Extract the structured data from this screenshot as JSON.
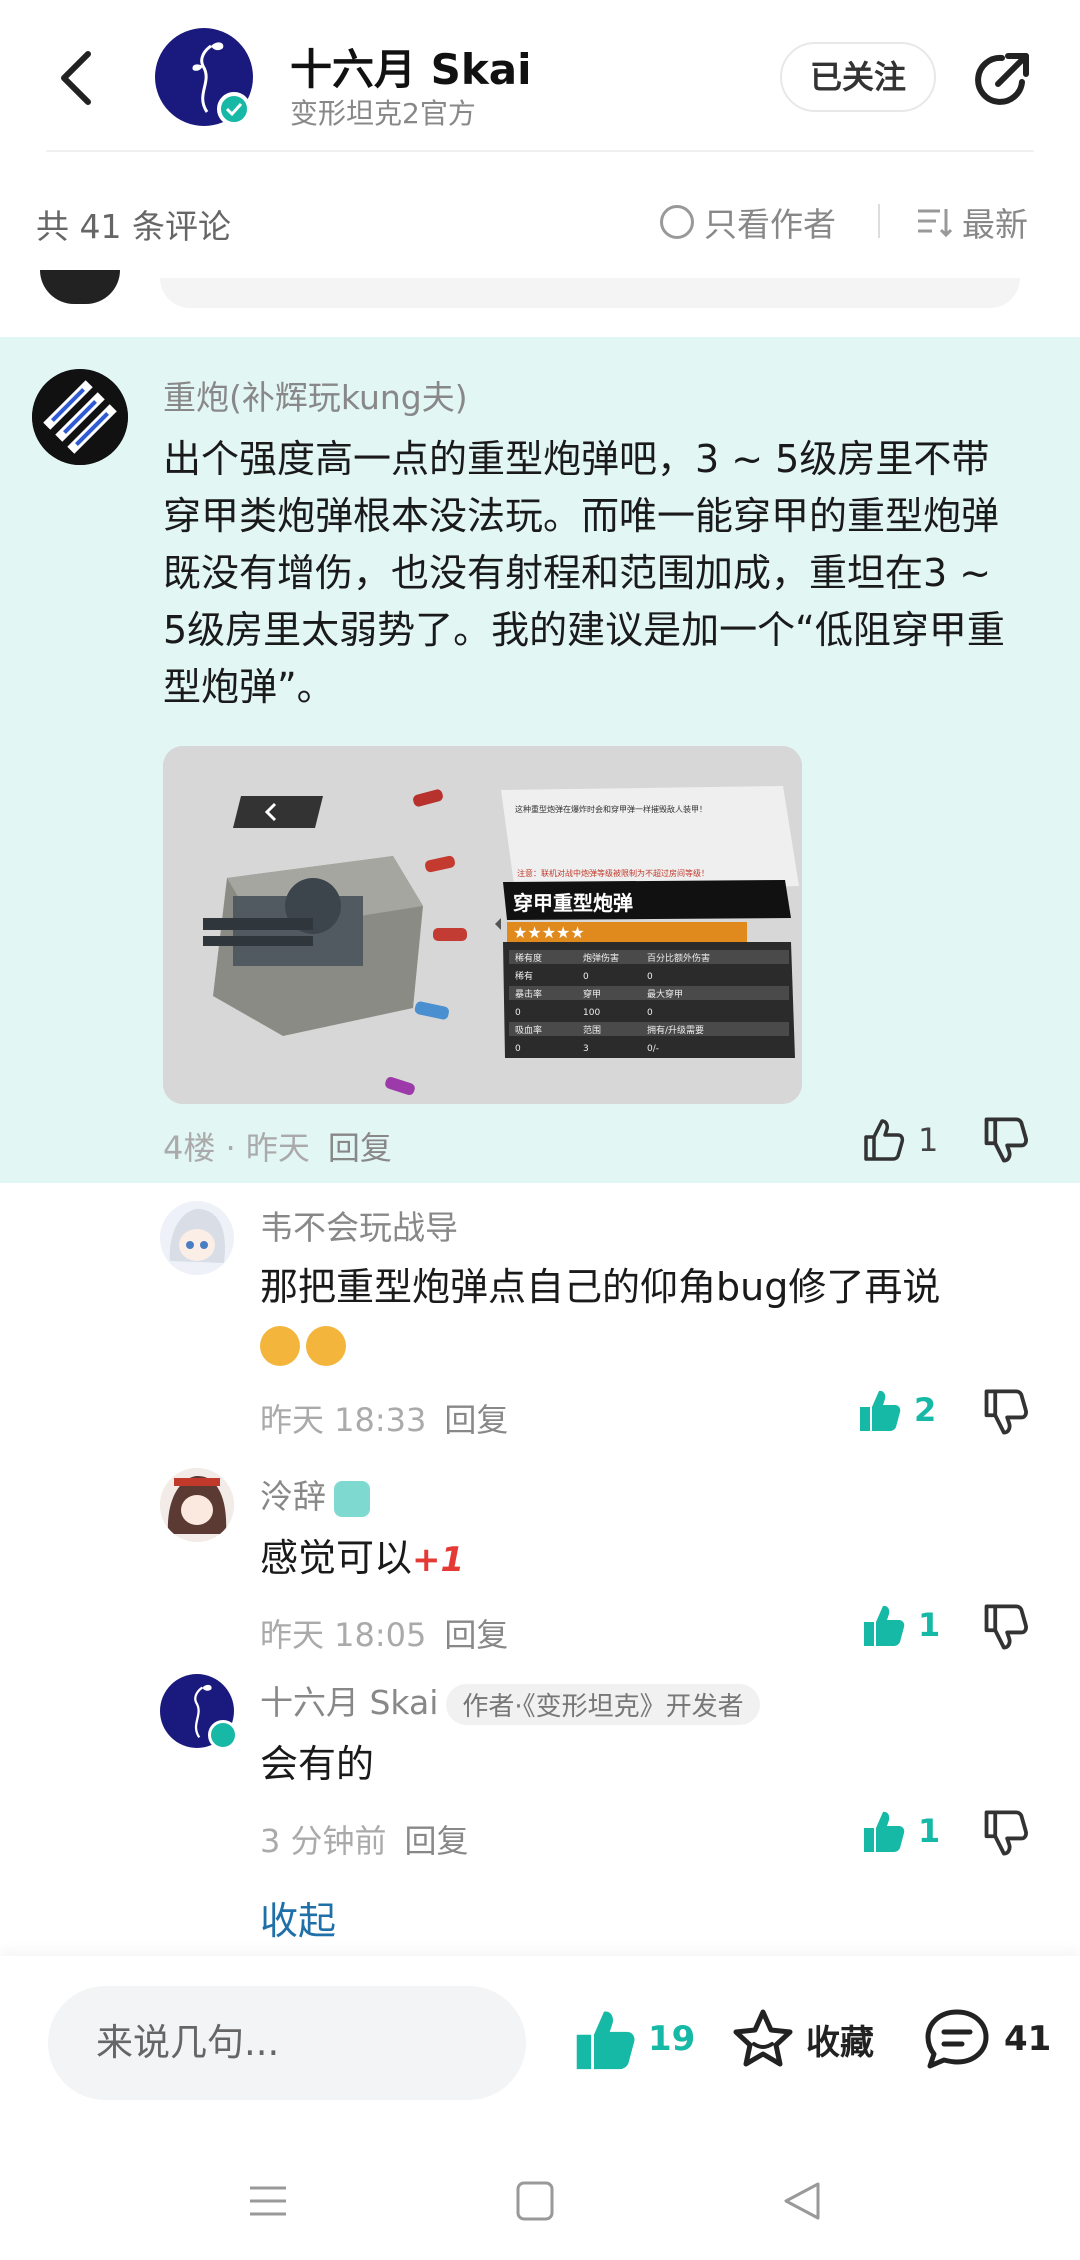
{
  "header": {
    "author_name": "十六月 Skai",
    "author_subtitle": "变形坦克2官方",
    "follow_label": "已关注"
  },
  "comment_bar": {
    "count_label": "共 41 条评论",
    "author_only_label": "只看作者",
    "sort_label": "最新"
  },
  "main_comment": {
    "username": "重炮(补辉玩kung夫)",
    "text": "出个强度高一点的重型炮弹吧，3 ~ 5级房里不带穿甲类炮弹根本没法玩。而唯一能穿甲的重型炮弹既没有增伤，也没有射程和范围加成，重坦在3 ~ 5级房里太弱势了。我的建议是加一个“低阻穿甲重型炮弹”。",
    "image": {
      "notice_text": "这种重型炮弹在爆炸时会和穿甲弹一样摧毁敌人装甲！",
      "warning_text": "注意：联机对战中炮弹等级被限制为不超过房间等级！",
      "item_name": "穿甲重型炮弹",
      "stars": "★★★★★",
      "stats": [
        [
          "稀有度",
          "炮弹伤害",
          "百分比额外伤害"
        ],
        [
          "稀有",
          "0",
          "0"
        ],
        [
          "暴击率",
          "穿甲",
          "最大穿甲"
        ],
        [
          "0",
          "100",
          "0"
        ],
        [
          "吸血率",
          "范围",
          "拥有/升级需要"
        ],
        [
          "0",
          "3",
          "0/-"
        ]
      ]
    },
    "meta": "4楼 · 昨天",
    "reply_label": "回复",
    "like_count": "1"
  },
  "replies": [
    {
      "username": "韦不会玩战导",
      "text": "那把重型炮弹点自己的仰角bug修了再说",
      "time": "昨天 18:33",
      "reply_label": "回复",
      "like_count": "2"
    },
    {
      "username": "泠辞",
      "text": "感觉可以",
      "plus_one": "+1",
      "time": "昨天 18:05",
      "reply_label": "回复",
      "like_count": "1"
    },
    {
      "username": "十六月 Skai",
      "author_tag": "作者·《变形坦克》开发者",
      "text": "会有的",
      "time": "3 分钟前",
      "reply_label": "回复",
      "like_count": "1"
    }
  ],
  "collapse_label": "收起",
  "bottom_bar": {
    "input_placeholder": "来说几句...",
    "like_count": "19",
    "favorite_label": "收藏",
    "comment_count": "41"
  },
  "colors": {
    "accent": "#16b8a6",
    "highlight_bg": "#e2f6f4",
    "link": "#1f6fa8",
    "avatar_navy": "#1a1a7e"
  },
  "icons": [
    "back-arrow-icon",
    "share-icon",
    "verified-icon",
    "radio-circle-icon",
    "sort-list-icon",
    "thumbs-up-icon",
    "thumbs-down-icon",
    "star-icon",
    "comment-bubble-icon",
    "nav-menu-icon",
    "nav-home-icon",
    "nav-back-icon"
  ]
}
